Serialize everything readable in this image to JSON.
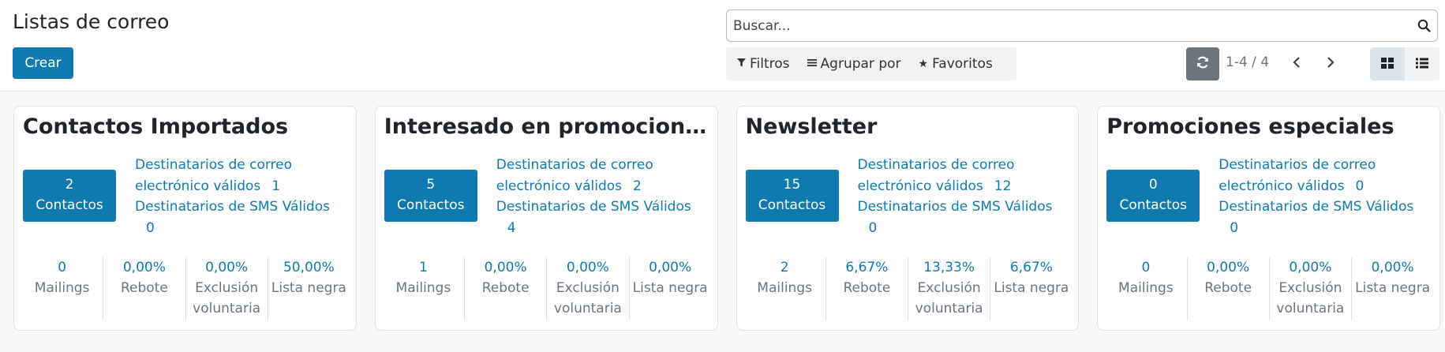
{
  "control_panel": {
    "title": "Listas de correo",
    "create_label": "Crear",
    "search_placeholder": "Buscar...",
    "filters_label": "Filtros",
    "group_by_label": "Agrupar por",
    "favorites_label": "Favoritos",
    "pager_value": "1-4 / 4"
  },
  "icons": {
    "search": "search-icon",
    "filter": "funnel-icon",
    "group_by": "list-lines-icon",
    "favorites": "star-icon",
    "refresh": "refresh-icon",
    "prev": "chevron-left-icon",
    "next": "chevron-right-icon",
    "kanban_view": "grid-icon",
    "list_view": "list-icon"
  },
  "colors": {
    "primary": "#0e7ab0",
    "muted": "#6c757d",
    "refresh_bg": "#6c757d"
  },
  "cards": [
    {
      "title": "Contactos Importados",
      "contacts_count": "2",
      "contacts_label": "Contactos",
      "email_label": "Destinatarios de correo electrónico válidos",
      "email_count": "1",
      "sms_label": "Destinatarios de SMS Válidos",
      "sms_count": "0",
      "stats": [
        {
          "value": "0",
          "label": "Mailings"
        },
        {
          "value": "0,00%",
          "label": "Rebote"
        },
        {
          "value": "0,00%",
          "label": "Exclusión voluntaria"
        },
        {
          "value": "50,00%",
          "label": "Lista negra"
        }
      ]
    },
    {
      "title": "Interesado en promociones ...",
      "contacts_count": "5",
      "contacts_label": "Contactos",
      "email_label": "Destinatarios de correo electrónico válidos",
      "email_count": "2",
      "sms_label": "Destinatarios de SMS Válidos",
      "sms_count": "4",
      "stats": [
        {
          "value": "1",
          "label": "Mailings"
        },
        {
          "value": "0,00%",
          "label": "Rebote"
        },
        {
          "value": "0,00%",
          "label": "Exclusión voluntaria"
        },
        {
          "value": "0,00%",
          "label": "Lista negra"
        }
      ]
    },
    {
      "title": "Newsletter",
      "contacts_count": "15",
      "contacts_label": "Contactos",
      "email_label": "Destinatarios de correo electrónico válidos",
      "email_count": "12",
      "sms_label": "Destinatarios de SMS Válidos",
      "sms_count": "0",
      "stats": [
        {
          "value": "2",
          "label": "Mailings"
        },
        {
          "value": "6,67%",
          "label": "Rebote"
        },
        {
          "value": "13,33%",
          "label": "Exclusión voluntaria"
        },
        {
          "value": "6,67%",
          "label": "Lista negra"
        }
      ]
    },
    {
      "title": "Promociones especiales",
      "contacts_count": "0",
      "contacts_label": "Contactos",
      "email_label": "Destinatarios de correo electrónico válidos",
      "email_count": "0",
      "sms_label": "Destinatarios de SMS Válidos",
      "sms_count": "0",
      "stats": [
        {
          "value": "0",
          "label": "Mailings"
        },
        {
          "value": "0,00%",
          "label": "Rebote"
        },
        {
          "value": "0,00%",
          "label": "Exclusión voluntaria"
        },
        {
          "value": "0,00%",
          "label": "Lista negra"
        }
      ]
    }
  ]
}
